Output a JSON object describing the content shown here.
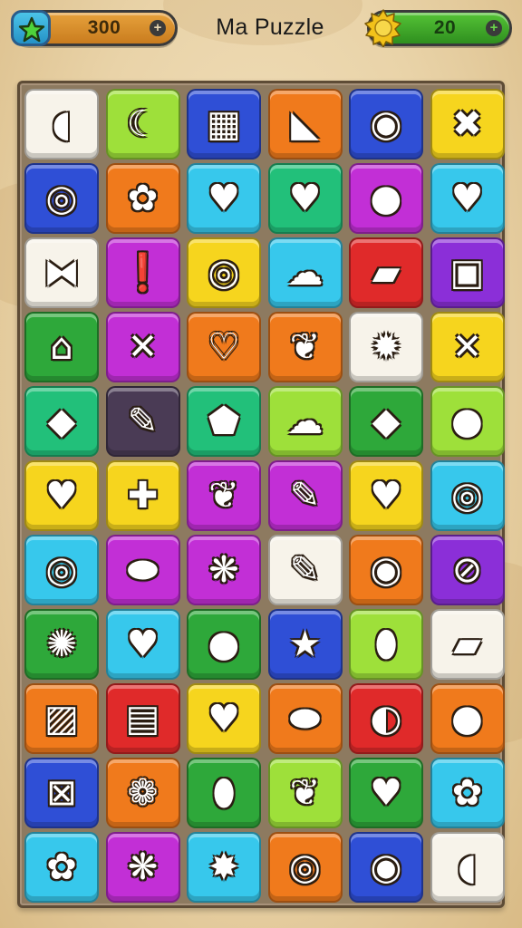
{
  "header": {
    "title": "Ma Puzzle",
    "stars_value": "300",
    "coins_value": "20",
    "stars_icon": "star-icon",
    "coins_icon": "sun-coin-icon"
  },
  "colors": {
    "white": "#f7f3ea",
    "lime": "#9ee03a",
    "blue": "#2f4fd6",
    "orange": "#f07a1c",
    "yellow": "#f6d51e",
    "cyan": "#37c8ec",
    "green": "#2ea83a",
    "teal": "#22c07a",
    "magenta": "#c22fd6",
    "purple": "#8b2fd8",
    "red": "#e02a2a",
    "dark": "#4a3b55"
  },
  "board": {
    "rows": [
      [
        {
          "color": "white",
          "icon": "lemon-icon",
          "glyph": "◖"
        },
        {
          "color": "lime",
          "icon": "croissant-icon",
          "glyph": "☾"
        },
        {
          "color": "blue",
          "icon": "chocolate-bar-icon",
          "glyph": "▦"
        },
        {
          "color": "orange",
          "icon": "carrot-icon",
          "glyph": "◣"
        },
        {
          "color": "blue",
          "icon": "ring-donut-icon",
          "glyph": "◉"
        },
        {
          "color": "yellow",
          "icon": "crossed-bones-icon",
          "glyph": "✖"
        }
      ],
      [
        {
          "color": "blue",
          "icon": "swirl-candy-icon",
          "glyph": "◎"
        },
        {
          "color": "orange",
          "icon": "flower-cookie-icon",
          "glyph": "✿"
        },
        {
          "color": "cyan",
          "icon": "heart-icon",
          "glyph": "♥"
        },
        {
          "color": "teal",
          "icon": "heart-leaf-icon",
          "glyph": "♥"
        },
        {
          "color": "magenta",
          "icon": "apple-icon",
          "glyph": "●"
        },
        {
          "color": "cyan",
          "icon": "strawberry-heart-icon",
          "glyph": "♥"
        }
      ],
      [
        {
          "color": "white",
          "icon": "wrapped-candy-icon",
          "glyph": "⧓"
        },
        {
          "color": "magenta",
          "icon": "exclamation-cookie-icon",
          "glyph": "❗"
        },
        {
          "color": "yellow",
          "icon": "lollipop-icon",
          "glyph": "◎"
        },
        {
          "color": "cyan",
          "icon": "bush-icon",
          "glyph": "☁"
        },
        {
          "color": "red",
          "icon": "cake-slice-icon",
          "glyph": "▰"
        },
        {
          "color": "purple",
          "icon": "book-icon",
          "glyph": "▣"
        }
      ],
      [
        {
          "color": "green",
          "icon": "cupcake-icon",
          "glyph": "⌂"
        },
        {
          "color": "magenta",
          "icon": "crossed-pencils-icon",
          "glyph": "✕"
        },
        {
          "color": "orange",
          "icon": "heart-outline-icon",
          "glyph": "♡"
        },
        {
          "color": "orange",
          "icon": "leaf-icon",
          "glyph": "❦"
        },
        {
          "color": "white",
          "icon": "gear-flower-icon",
          "glyph": "✹"
        },
        {
          "color": "yellow",
          "icon": "crossed-tools-icon",
          "glyph": "✕"
        }
      ],
      [
        {
          "color": "teal",
          "icon": "diamond-candy-icon",
          "glyph": "◆"
        },
        {
          "color": "dark",
          "icon": "pencil-icon",
          "glyph": "✎"
        },
        {
          "color": "teal",
          "icon": "shield-icon",
          "glyph": "⬟"
        },
        {
          "color": "lime",
          "icon": "ice-cream-icon",
          "glyph": "☁"
        },
        {
          "color": "green",
          "icon": "lemon-leaf-icon",
          "glyph": "◆"
        },
        {
          "color": "lime",
          "icon": "radish-icon",
          "glyph": "●"
        }
      ],
      [
        {
          "color": "yellow",
          "icon": "crossed-heart-icon",
          "glyph": "♥"
        },
        {
          "color": "yellow",
          "icon": "plus-cross-icon",
          "glyph": "✚"
        },
        {
          "color": "magenta",
          "icon": "green-leaf-icon",
          "glyph": "❦"
        },
        {
          "color": "magenta",
          "icon": "pen-icon",
          "glyph": "✎"
        },
        {
          "color": "yellow",
          "icon": "red-heart-icon",
          "glyph": "♥"
        },
        {
          "color": "cyan",
          "icon": "gem-ring-icon",
          "glyph": "◎"
        }
      ],
      [
        {
          "color": "cyan",
          "icon": "target-candy-icon",
          "glyph": "◎"
        },
        {
          "color": "magenta",
          "icon": "bread-roll-icon",
          "glyph": "⬬"
        },
        {
          "color": "magenta",
          "icon": "pineapple-icon",
          "glyph": "❋"
        },
        {
          "color": "white",
          "icon": "marker-icon",
          "glyph": "✎"
        },
        {
          "color": "orange",
          "icon": "donut-icon",
          "glyph": "◉"
        },
        {
          "color": "purple",
          "icon": "striped-ball-icon",
          "glyph": "⊘"
        }
      ],
      [
        {
          "color": "green",
          "icon": "sun-berry-icon",
          "glyph": "✺"
        },
        {
          "color": "cyan",
          "icon": "green-heart-icon",
          "glyph": "♥"
        },
        {
          "color": "green",
          "icon": "red-apple-icon",
          "glyph": "●"
        },
        {
          "color": "blue",
          "icon": "star-icon",
          "glyph": "★"
        },
        {
          "color": "lime",
          "icon": "blue-bean-icon",
          "glyph": "⬮"
        },
        {
          "color": "white",
          "icon": "eraser-icon",
          "glyph": "▰"
        }
      ],
      [
        {
          "color": "orange",
          "icon": "picture-frame-icon",
          "glyph": "▨"
        },
        {
          "color": "red",
          "icon": "flag-cake-icon",
          "glyph": "▤"
        },
        {
          "color": "yellow",
          "icon": "orange-heart-icon",
          "glyph": "♥"
        },
        {
          "color": "orange",
          "icon": "plum-icon",
          "glyph": "⬬"
        },
        {
          "color": "red",
          "icon": "lime-fruit-icon",
          "glyph": "◐"
        },
        {
          "color": "orange",
          "icon": "tomato-icon",
          "glyph": "●"
        }
      ],
      [
        {
          "color": "blue",
          "icon": "briefcase-icon",
          "glyph": "⊠"
        },
        {
          "color": "orange",
          "icon": "berry-icon",
          "glyph": "❁"
        },
        {
          "color": "green",
          "icon": "yellow-leaf-icon",
          "glyph": "⬮"
        },
        {
          "color": "lime",
          "icon": "leaf-badge-icon",
          "glyph": "❦"
        },
        {
          "color": "green",
          "icon": "cherry-heart-icon",
          "glyph": "♥"
        },
        {
          "color": "cyan",
          "icon": "starfish-flower-icon",
          "glyph": "✿"
        }
      ],
      [
        {
          "color": "cyan",
          "icon": "pink-flower-icon",
          "glyph": "✿"
        },
        {
          "color": "magenta",
          "icon": "pineapple-small-icon",
          "glyph": "❋"
        },
        {
          "color": "cyan",
          "icon": "seal-badge-icon",
          "glyph": "✸"
        },
        {
          "color": "orange",
          "icon": "spiral-roll-icon",
          "glyph": "◎"
        },
        {
          "color": "blue",
          "icon": "orange-ring-icon",
          "glyph": "◉"
        },
        {
          "color": "white",
          "icon": "lemon-yellow-icon",
          "glyph": "◖"
        }
      ]
    ]
  }
}
